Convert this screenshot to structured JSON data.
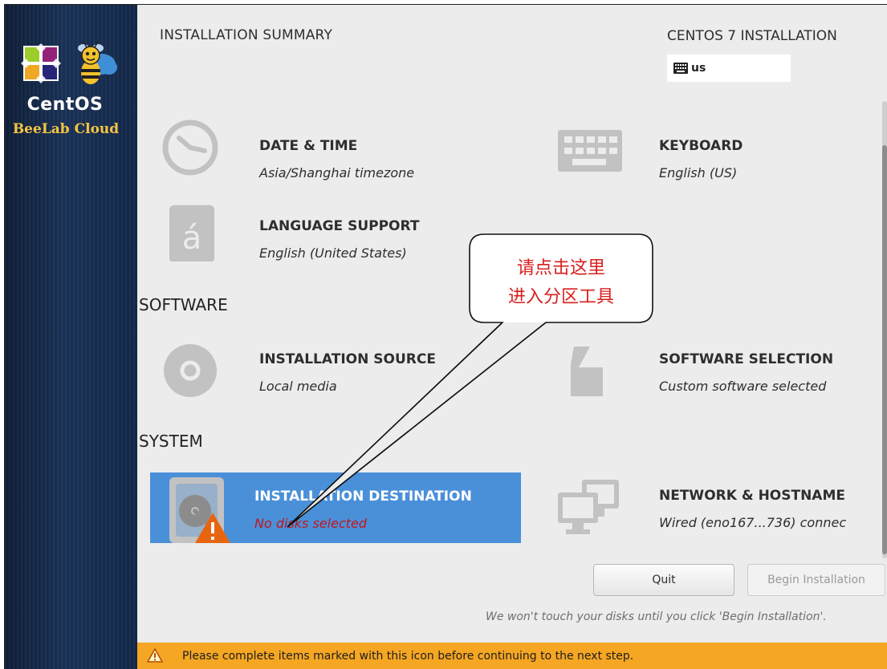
{
  "sidebar": {
    "brand_name": "CentOS",
    "brand_subtitle": "BeeLab Cloud"
  },
  "header": {
    "title": "INSTALLATION SUMMARY",
    "product": "CENTOS 7 INSTALLATION",
    "keyboard_layout": "us",
    "keyboard_icon": "keyboard-icon"
  },
  "sections": {
    "software": "SOFTWARE",
    "system": "SYSTEM"
  },
  "spokes": {
    "date_time": {
      "title": "DATE & TIME",
      "status": "Asia/Shanghai timezone",
      "icon": "clock-icon"
    },
    "keyboard": {
      "title": "KEYBOARD",
      "status": "English (US)",
      "icon": "keyboard-icon"
    },
    "language": {
      "title": "LANGUAGE SUPPORT",
      "status": "English (United States)",
      "icon": "language-icon"
    },
    "install_source": {
      "title": "INSTALLATION SOURCE",
      "status": "Local media",
      "icon": "disc-icon"
    },
    "software_selection": {
      "title": "SOFTWARE SELECTION",
      "status": "Custom software selected",
      "icon": "package-icon"
    },
    "install_dest": {
      "title": "INSTALLATION DESTINATION",
      "status": "No disks selected",
      "icon": "hard-disk-icon"
    },
    "network": {
      "title": "NETWORK & HOSTNAME",
      "status": "Wired (eno167...736) connec",
      "icon": "network-icon"
    }
  },
  "buttons": {
    "quit": "Quit",
    "begin": "Begin Installation"
  },
  "hint": "We won't touch your disks until you click 'Begin Installation'.",
  "warning_bar": {
    "text": "Please complete items marked with this icon before continuing to the next step.",
    "icon": "warning-icon"
  },
  "callout": {
    "line1": "请点击这里",
    "line2": "进入分区工具"
  },
  "colors": {
    "selected_spoke": "#4a90d9",
    "warning": "#f5a623",
    "error_text": "#c4151c",
    "callout_text": "#d81e1e"
  }
}
